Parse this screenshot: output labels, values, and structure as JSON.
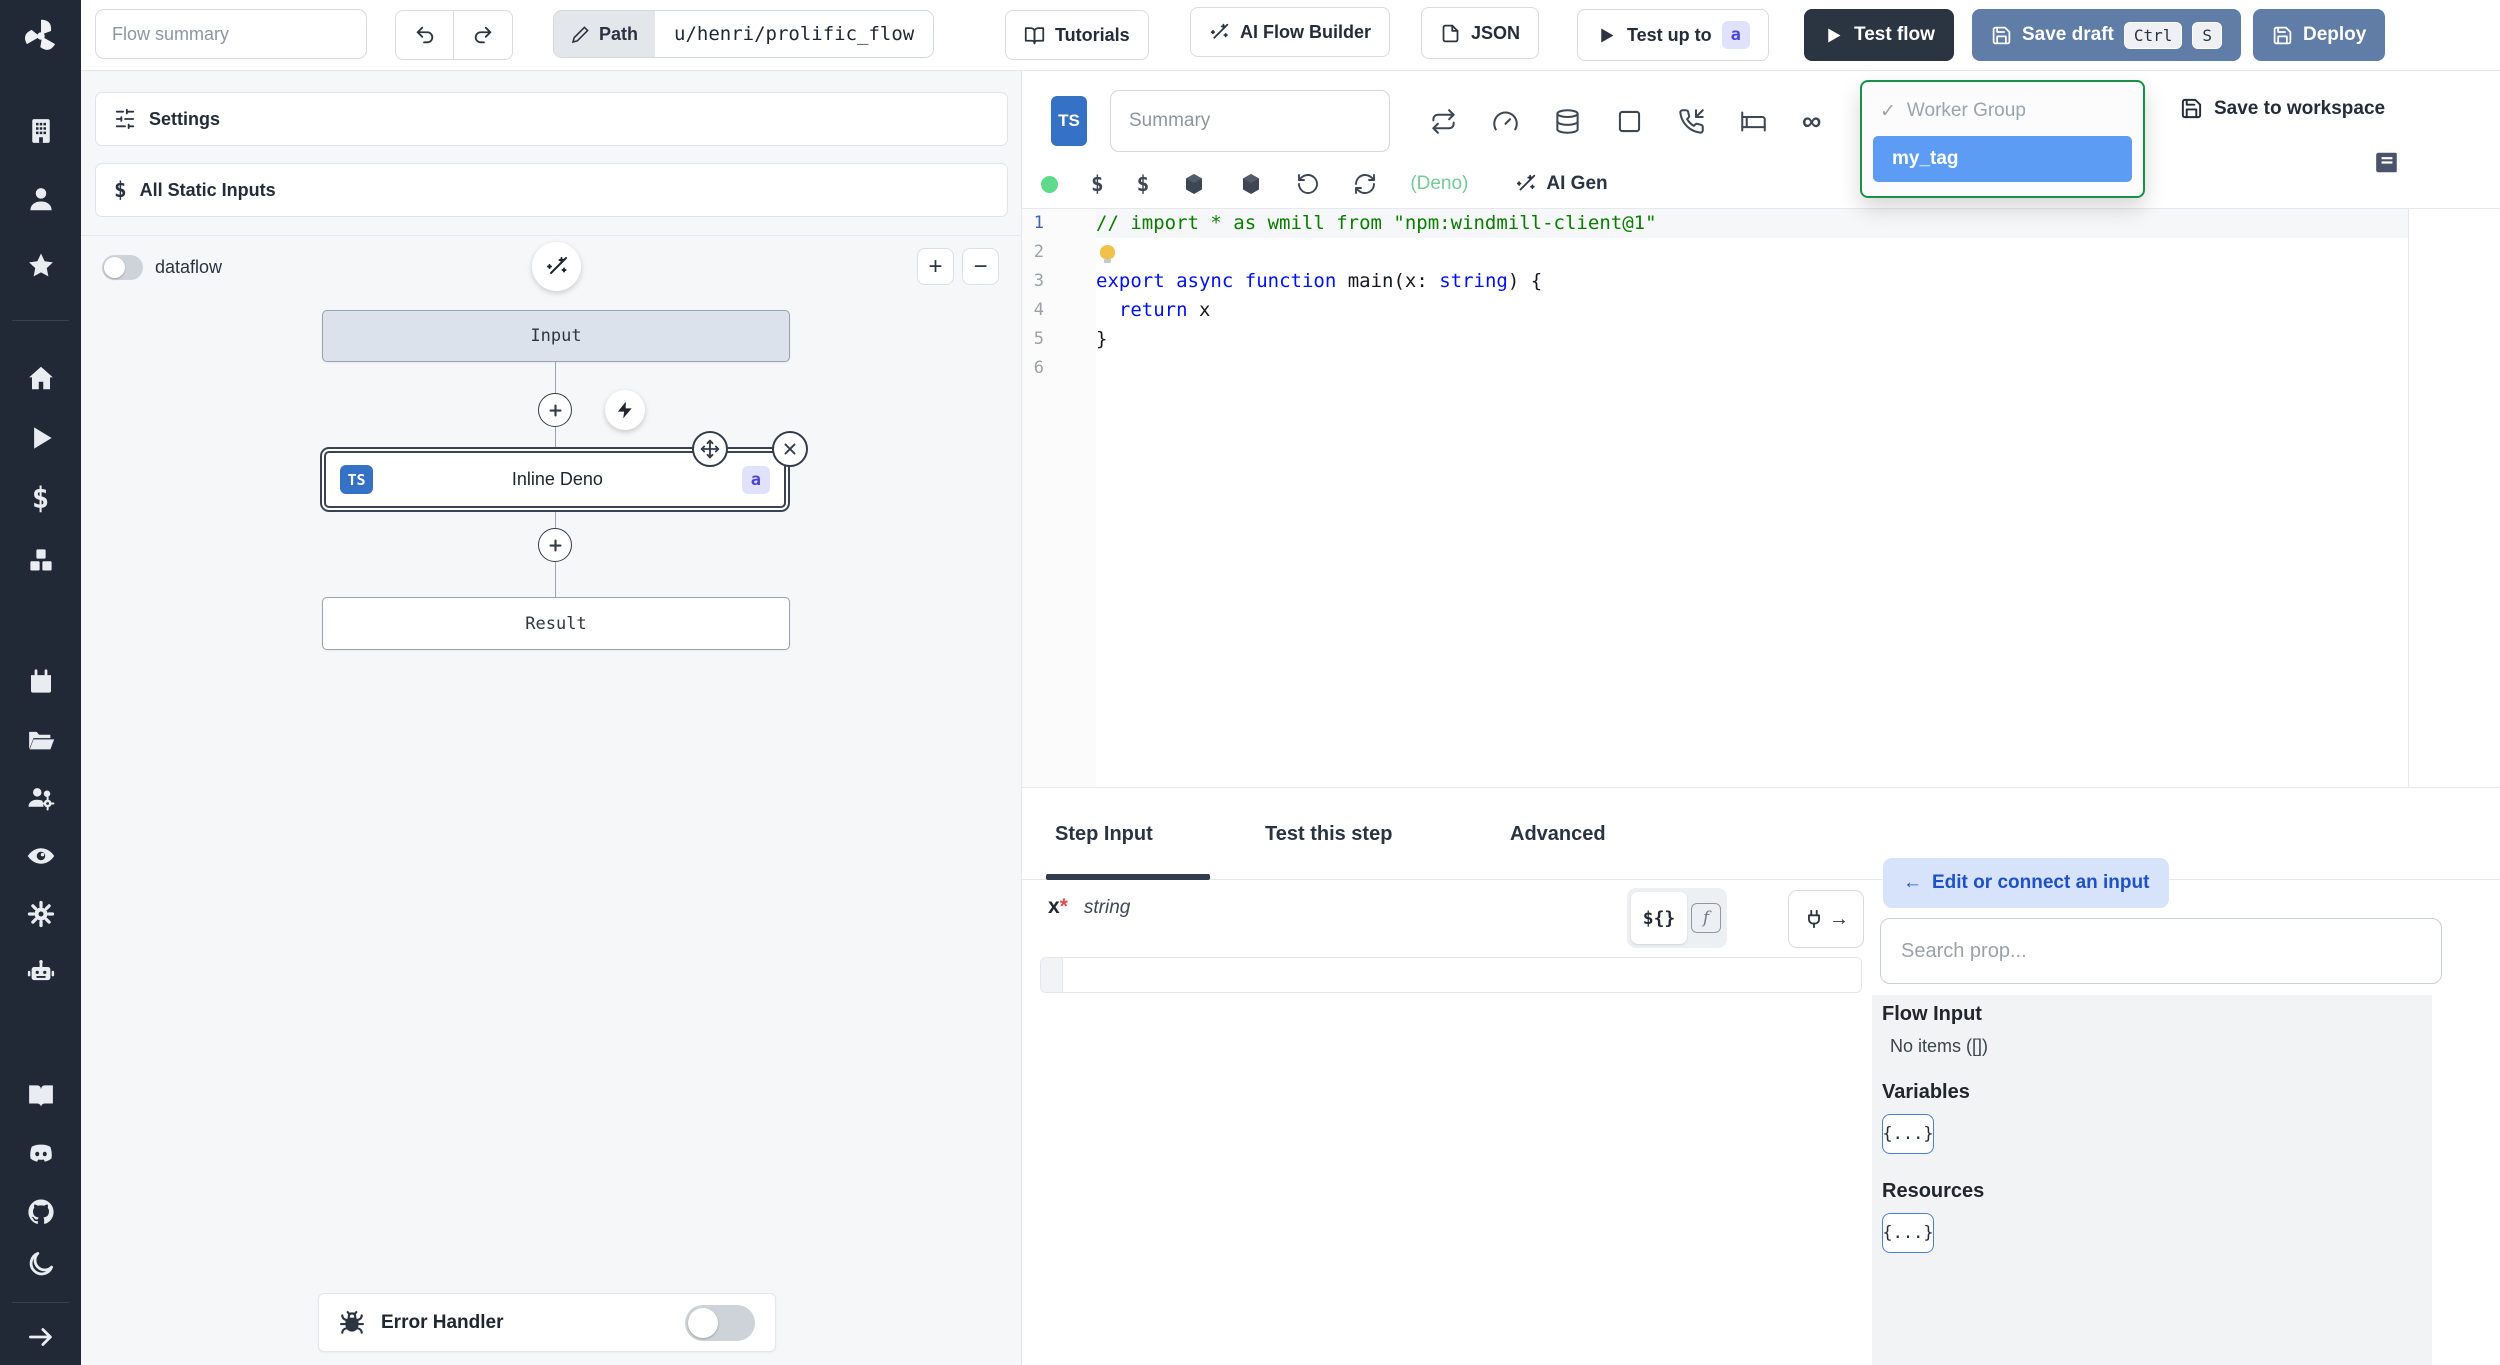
{
  "topbar": {
    "flow_summary_placeholder": "Flow summary",
    "path_label": "Path",
    "path_value": "u/henri/prolific_flow",
    "tutorials": "Tutorials",
    "ai_flow_builder": "AI Flow Builder",
    "json": "JSON",
    "test_up_to": "Test up to",
    "test_up_to_badge": "a",
    "test_flow": "Test flow",
    "save_draft": "Save draft",
    "kbd_ctrl": "Ctrl",
    "kbd_s": "S",
    "deploy": "Deploy"
  },
  "flow_panel": {
    "settings": "Settings",
    "all_static_inputs": "All Static Inputs",
    "static_inputs_icon": "$",
    "dataflow_label": "dataflow",
    "dataflow_on": false,
    "zoom_in": "+",
    "zoom_out": "−",
    "nodes": {
      "input": "Input",
      "step_lang_badge": "TS",
      "step_label": "Inline Deno",
      "step_id_badge": "a",
      "result": "Result"
    },
    "error_handler": "Error Handler",
    "error_handler_on": false
  },
  "editor": {
    "lang_badge": "TS",
    "summary_placeholder": "Summary",
    "icons": {
      "dollar": "$",
      "infinity": "∞"
    },
    "lang_hint": "(Deno)",
    "ai_gen_label": "AI Gen",
    "dropdown": {
      "check": "✓",
      "group_label": "Worker Group",
      "selected": "my_tag"
    },
    "save_to_workspace": "Save to workspace",
    "active_line": 0,
    "syntax": {
      "comment": "#0a7d00",
      "keyword": "#0010ee",
      "plain": "#16181d"
    },
    "code_lines": [
      [
        {
          "t": "// import * as wmill from \"npm:windmill-client@1\"",
          "c": "comment"
        }
      ],
      [
        {
          "icon": "lightbulb"
        }
      ],
      [
        {
          "t": "export",
          "c": "keyword"
        },
        {
          "t": " ",
          "c": "plain"
        },
        {
          "t": "async",
          "c": "keyword"
        },
        {
          "t": " ",
          "c": "plain"
        },
        {
          "t": "function",
          "c": "keyword"
        },
        {
          "t": " main(x: ",
          "c": "plain"
        },
        {
          "t": "string",
          "c": "keyword"
        },
        {
          "t": ") {",
          "c": "plain"
        }
      ],
      [
        {
          "t": "  ",
          "c": "plain"
        },
        {
          "t": "return",
          "c": "keyword"
        },
        {
          "t": " x",
          "c": "plain"
        }
      ],
      [
        {
          "t": "}",
          "c": "plain"
        }
      ],
      []
    ]
  },
  "bottom": {
    "tabs": [
      "Step Input",
      "Test this step",
      "Advanced"
    ],
    "active_tab": "Step Input",
    "field": {
      "name": "x",
      "required": "*",
      "type": "string",
      "value": ""
    },
    "template_toggle": {
      "dollar_brace": "${}",
      "fn": "f"
    },
    "plug_arrow": "→",
    "connect_arrow": "←",
    "connect_label": "Edit or connect an input",
    "search_placeholder": "Search prop...",
    "sections": {
      "flow_input": "Flow Input",
      "no_items": "No items ([])",
      "variables": "Variables",
      "resources": "Resources",
      "object_button": "{...}"
    }
  },
  "colors": {
    "sidebar_bg": "#212836",
    "primary_dark_button": "#2b3441",
    "slate_button": "#5f7da6",
    "dropdown_border_green": "#199049",
    "selected_option_blue": "#5c9cf5",
    "ts_badge_blue": "#3571c4",
    "id_badge_bg": "#e0e2fc",
    "id_badge_text": "#4a44d6",
    "deno_hint_green": "#74cb96",
    "status_dot_green": "#5fd98a",
    "connect_chip_bg": "#d6e3fb",
    "connect_chip_text": "#1e50c8",
    "panel_gray": "#f6f7f9",
    "required_red": "#e5484d"
  }
}
